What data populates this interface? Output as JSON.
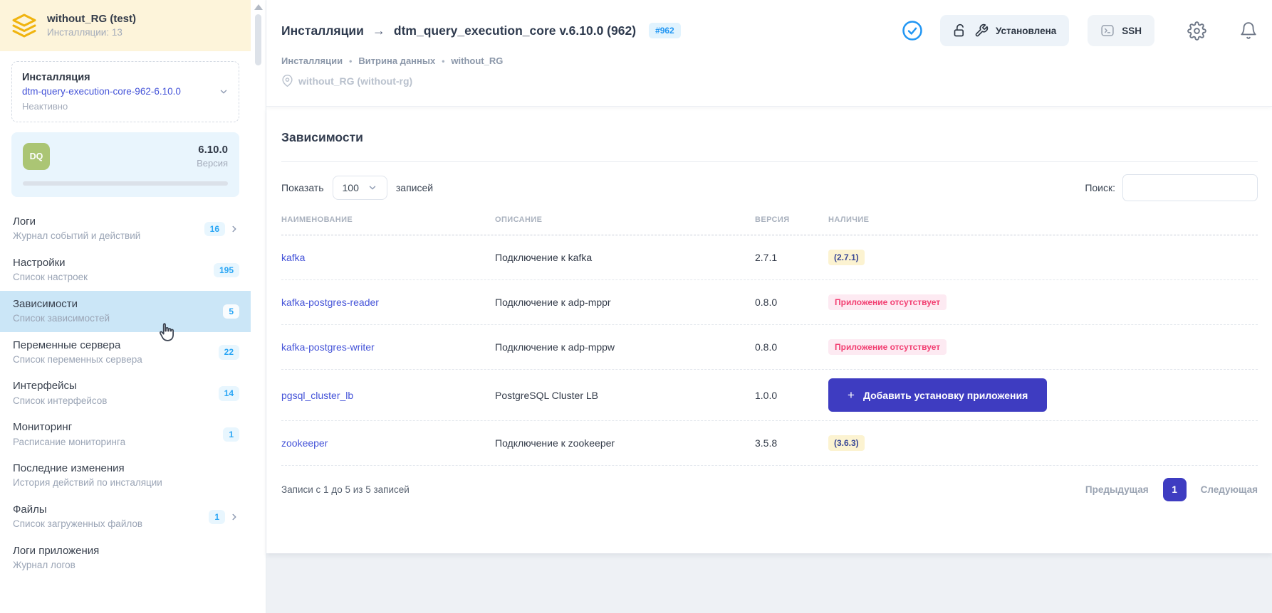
{
  "workspace": {
    "title": "without_RG (test)",
    "subtitle": "Инсталляции: 13"
  },
  "installation_card": {
    "label": "Инсталляция",
    "name": "dtm-query-execution-core-962-6.10.0",
    "status": "Неактивно"
  },
  "version_card": {
    "badge": "DQ",
    "version": "6.10.0",
    "label": "Версия"
  },
  "menu": [
    {
      "title": "Логи",
      "subtitle": "Журнал событий и действий",
      "badge": "16"
    },
    {
      "title": "Настройки",
      "subtitle": "Список настроек",
      "badge": "195"
    },
    {
      "title": "Зависимости",
      "subtitle": "Список зависимостей",
      "badge": "5"
    },
    {
      "title": "Переменные сервера",
      "subtitle": "Список переменных сервера",
      "badge": "22"
    },
    {
      "title": "Интерфейсы",
      "subtitle": "Список интерфейсов",
      "badge": "14"
    },
    {
      "title": "Мониторинг",
      "subtitle": "Расписание мониторинга",
      "badge": "1"
    },
    {
      "title": "Последние изменения",
      "subtitle": "История действий по инсталяции",
      "badge": ""
    },
    {
      "title": "Файлы",
      "subtitle": "Список загруженных файлов",
      "badge": "1"
    },
    {
      "title": "Логи приложения",
      "subtitle": "Журнал логов",
      "badge": ""
    }
  ],
  "header": {
    "title_prefix": "Инсталляции",
    "title_arrow": "→",
    "title": "dtm_query_execution_core v.6.10.0 (962)",
    "id_badge": "#962",
    "breadcrumb": [
      "Инсталляции",
      "Витрина данных",
      "without_RG"
    ],
    "breadcrumb_separator": "•",
    "location": "without_RG (without-rg)",
    "status_button": "Установлена",
    "ssh_button": "SSH"
  },
  "content": {
    "heading": "Зависимости",
    "show_label": "Показать",
    "page_size": "100",
    "records_label": "записей",
    "search_label": "Поиск:",
    "add_button_plus": "+",
    "table": {
      "columns": [
        "НАИМЕНОВАНИЕ",
        "ОПИСАНИЕ",
        "ВЕРСИЯ",
        "НАЛИЧИЕ"
      ],
      "rows": [
        {
          "name": "kafka",
          "description": "Подключение к kafka",
          "version": "2.7.1",
          "availability": "(2.7.1)",
          "availability_type": "version"
        },
        {
          "name": "kafka-postgres-reader",
          "description": "Подключение к adp-mppr",
          "version": "0.8.0",
          "availability": "Приложение отсутствует",
          "availability_type": "missing"
        },
        {
          "name": "kafka-postgres-writer",
          "description": "Подключение к adp-mppw",
          "version": "0.8.0",
          "availability": "Приложение отсутствует",
          "availability_type": "missing"
        },
        {
          "name": "pgsql_cluster_lb",
          "description": "PostgreSQL Cluster LB",
          "version": "1.0.0",
          "availability": "Добавить установку приложения",
          "availability_type": "button"
        },
        {
          "name": "zookeeper",
          "description": "Подключение к zookeeper",
          "version": "3.5.8",
          "availability": "(3.6.3)",
          "availability_type": "version"
        }
      ]
    },
    "footer": {
      "records_info": "Записи с 1 до 5 из 5 записей",
      "prev": "Предыдущая",
      "page": "1",
      "next": "Следующая"
    }
  },
  "icons": {
    "layers-icon": "stacked layers (workspace)",
    "chevron-down-icon": "expand installation selector",
    "chevron-right-icon": "drill into menu item",
    "check-circle-icon": "installation ok status",
    "unlock-icon": "unlocked state",
    "wrench-icon": "installed / maintenance",
    "terminal-icon": "ssh terminal",
    "gear-icon": "settings",
    "bell-icon": "notifications",
    "map-pin-icon": "location",
    "cursor-pointer": "mouse hand cursor"
  },
  "colors": {
    "accent_blue": "#2196f3",
    "count_badge_bg": "#e8f6fe",
    "selected_item_bg": "#cbe6f7",
    "workspace_header_bg": "#fdf4da",
    "layers_icon": "#f0b40f",
    "dq_badge": "#a6c169",
    "version_card_bg": "#e9f5fd",
    "link_blue": "#4453d8",
    "primary_button": "#3e3cc1",
    "version_badge_bg": "#fcf3d1",
    "version_badge_text": "#3a4896",
    "missing_badge_bg": "#fdeaf2",
    "missing_badge_text": "#f23f72"
  }
}
